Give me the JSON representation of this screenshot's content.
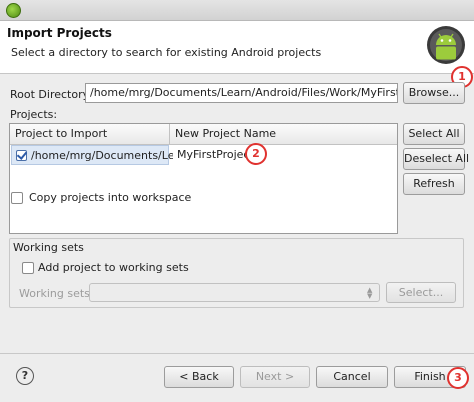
{
  "header": {
    "title": "Import Projects",
    "description": "Select a directory to search for existing Android projects"
  },
  "root": {
    "label": "Root Directory:",
    "value": "/home/mrg/Documents/Learn/Android/Files/Work/MyFirstApp",
    "browse_label": "Browse..."
  },
  "projects": {
    "label": "Projects:",
    "columns": [
      "Project to Import",
      "New Project Name"
    ],
    "rows": [
      {
        "project": "/home/mrg/Documents/Learn",
        "new_name": "MyFirstProject",
        "checked": true
      }
    ],
    "select_all_label": "Select All",
    "deselect_all_label": "Deselect All",
    "refresh_label": "Refresh"
  },
  "copy_label": "Copy projects into workspace",
  "working_sets": {
    "group_label": "Working sets",
    "add_label": "Add project to working sets",
    "sets_label": "Working sets:",
    "select_label": "Select..."
  },
  "footer": {
    "help_glyph": "?",
    "back_label": "< Back",
    "next_label": "Next >",
    "cancel_label": "Cancel",
    "finish_label": "Finish"
  },
  "callouts": [
    "1",
    "2",
    "3"
  ],
  "colors": {
    "callout": "#e0322f",
    "android_green": "#8bc34a"
  },
  "icons": {
    "window": "eclipse-window-icon",
    "header": "android-robot-icon"
  }
}
